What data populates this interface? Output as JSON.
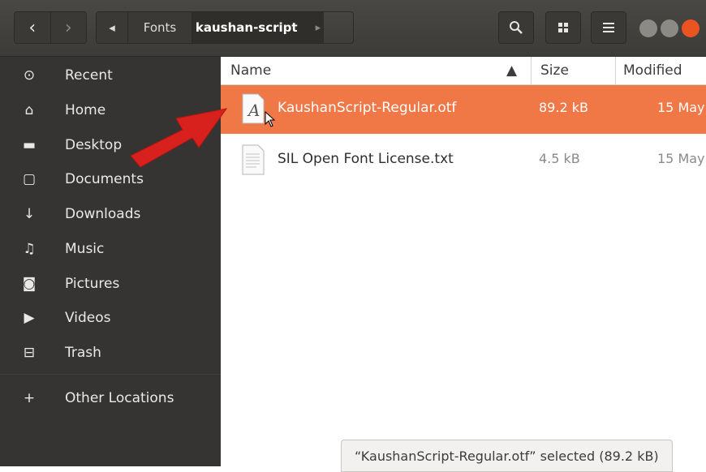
{
  "header": {
    "nav": {
      "back": "‹",
      "forward": "›"
    },
    "path_left_arrow": "◂",
    "path": [
      "Fonts",
      "kaushan-script"
    ],
    "path_right_arrow": "▸",
    "search_icon": "search-icon",
    "view_icon": "grid-icon",
    "menu_icon": "menu-icon",
    "accent": "#e95420"
  },
  "sidebar": {
    "items": [
      {
        "label": "Recent",
        "icon": "⊙"
      },
      {
        "label": "Home",
        "icon": "⌂"
      },
      {
        "label": "Desktop",
        "icon": "▬"
      },
      {
        "label": "Documents",
        "icon": "▢"
      },
      {
        "label": "Downloads",
        "icon": "↓"
      },
      {
        "label": "Music",
        "icon": "♫"
      },
      {
        "label": "Pictures",
        "icon": "◙"
      },
      {
        "label": "Videos",
        "icon": "▶"
      },
      {
        "label": "Trash",
        "icon": "⊟"
      },
      {
        "label": "Other Locations",
        "icon": "+"
      }
    ]
  },
  "columns": {
    "name": "Name",
    "size": "Size",
    "modified": "Modified"
  },
  "files": [
    {
      "name": "KaushanScript-Regular.otf",
      "size": "89.2 kB",
      "modified": "15 May",
      "selected": true,
      "icon": "font-file-icon"
    },
    {
      "name": "SIL Open Font License.txt",
      "size": "4.5 kB",
      "modified": "15 May",
      "selected": false,
      "icon": "text-file-icon"
    }
  ],
  "status": "“KaushanScript-Regular.otf” selected  (89.2 kB)",
  "selection_color": "#f07746"
}
